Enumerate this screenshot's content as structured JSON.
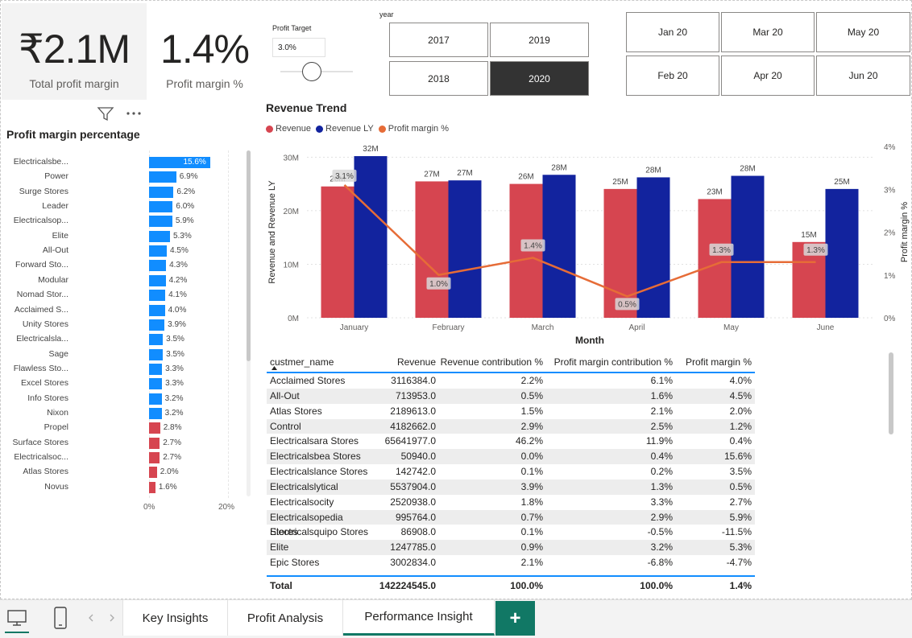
{
  "cards": [
    {
      "value": "₹2.1M",
      "label": "Total profit margin"
    },
    {
      "value": "1.4%",
      "label": "Profit margin %"
    }
  ],
  "profit_target": {
    "label": "Profit Target",
    "value": "3.0%",
    "slider_level": 0.45
  },
  "year_slicer": {
    "label": "year",
    "options": [
      "2017",
      "2019",
      "2018",
      "2020"
    ],
    "selected": "2020"
  },
  "month_slicer": {
    "options": [
      "Jan 20",
      "Mar 20",
      "May 20",
      "Feb 20",
      "Apr 20",
      "Jun 20"
    ]
  },
  "profit_margin_chart": {
    "title": "Profit margin percentage",
    "axis_labels": [
      "0%",
      "20%"
    ],
    "positive_color": "#118dff",
    "negative_color": "#d64550",
    "selected_color": "#118dff",
    "rows": [
      {
        "name": "Electricalsbe...",
        "value": 15.6,
        "label": "15.6%"
      },
      {
        "name": "Power",
        "value": 6.9,
        "label": "6.9%"
      },
      {
        "name": "Surge Stores",
        "value": 6.2,
        "label": "6.2%"
      },
      {
        "name": "Leader",
        "value": 6.0,
        "label": "6.0%"
      },
      {
        "name": "Electricalsop...",
        "value": 5.9,
        "label": "5.9%"
      },
      {
        "name": "Elite",
        "value": 5.3,
        "label": "5.3%"
      },
      {
        "name": "All-Out",
        "value": 4.5,
        "label": "4.5%"
      },
      {
        "name": "Forward Sto...",
        "value": 4.3,
        "label": "4.3%"
      },
      {
        "name": "Modular",
        "value": 4.2,
        "label": "4.2%"
      },
      {
        "name": "Nomad Stor...",
        "value": 4.1,
        "label": "4.1%"
      },
      {
        "name": "Acclaimed S...",
        "value": 4.0,
        "label": "4.0%"
      },
      {
        "name": "Unity Stores",
        "value": 3.9,
        "label": "3.9%"
      },
      {
        "name": "Electricalsla...",
        "value": 3.5,
        "label": "3.5%"
      },
      {
        "name": "Sage",
        "value": 3.5,
        "label": "3.5%"
      },
      {
        "name": "Flawless Sto...",
        "value": 3.3,
        "label": "3.3%"
      },
      {
        "name": "Excel Stores",
        "value": 3.3,
        "label": "3.3%"
      },
      {
        "name": "Info Stores",
        "value": 3.2,
        "label": "3.2%"
      },
      {
        "name": "Nixon",
        "value": 3.2,
        "label": "3.2%"
      },
      {
        "name": "Propel",
        "value": 2.8,
        "label": "2.8%",
        "below_target": true
      },
      {
        "name": "Surface Stores",
        "value": 2.7,
        "label": "2.7%",
        "below_target": true
      },
      {
        "name": "Electricalsoc...",
        "value": 2.7,
        "label": "2.7%",
        "below_target": true
      },
      {
        "name": "Atlas Stores",
        "value": 2.0,
        "label": "2.0%",
        "below_target": true
      },
      {
        "name": "Novus",
        "value": 1.6,
        "label": "1.6%",
        "below_target": true
      }
    ]
  },
  "chart_data": {
    "type": "bar",
    "title": "Revenue Trend",
    "xlabel": "Month",
    "ylabel": "Revenue and Revenue LY",
    "y2label": "Profit margin %",
    "categories": [
      "January",
      "February",
      "March",
      "April",
      "May",
      "June"
    ],
    "ylim": [
      0,
      32
    ],
    "yticks": [
      "0M",
      "10M",
      "20M",
      "30M"
    ],
    "y2lim": [
      0,
      4
    ],
    "y2ticks": [
      "0%",
      "1%",
      "2%",
      "3%",
      "4%"
    ],
    "legend_position": "top-left",
    "grid": true,
    "series": [
      {
        "name": "Revenue",
        "type": "bar",
        "color": "#d64550",
        "values": [
          26,
          27,
          26.5,
          25.5,
          23.5,
          15
        ],
        "labels": [
          "26M",
          "27M",
          "26M",
          "25M",
          "23M",
          "15M"
        ]
      },
      {
        "name": "Revenue LY",
        "type": "bar",
        "color": "#12239e",
        "values": [
          32,
          27.2,
          28.3,
          27.8,
          28.1,
          25.5
        ],
        "labels": [
          "32M",
          "27M",
          "28M",
          "28M",
          "28M",
          "25M"
        ]
      },
      {
        "name": "Profit margin %",
        "type": "line",
        "color": "#e66c37",
        "values": [
          3.1,
          1.0,
          1.4,
          0.5,
          1.3,
          1.3
        ],
        "labels": [
          "3.1%",
          "1.0%",
          "1.4%",
          "0.5%",
          "1.3%",
          "1.3%"
        ]
      }
    ]
  },
  "table": {
    "columns": [
      "custmer_name",
      "Revenue",
      "Revenue contribution %",
      "Profit margin contribution %",
      "Profit margin %"
    ],
    "rows": [
      [
        "Acclaimed Stores",
        "3116384.0",
        "2.2%",
        "6.1%",
        "4.0%"
      ],
      [
        "All-Out",
        "713953.0",
        "0.5%",
        "1.6%",
        "4.5%"
      ],
      [
        "Atlas Stores",
        "2189613.0",
        "1.5%",
        "2.1%",
        "2.0%"
      ],
      [
        "Control",
        "4182662.0",
        "2.9%",
        "2.5%",
        "1.2%"
      ],
      [
        "Electricalsara Stores",
        "65641977.0",
        "46.2%",
        "11.9%",
        "0.4%"
      ],
      [
        "Electricalsbea Stores",
        "50940.0",
        "0.0%",
        "0.4%",
        "15.6%"
      ],
      [
        "Electricalslance Stores",
        "142742.0",
        "0.1%",
        "0.2%",
        "3.5%"
      ],
      [
        "Electricalslytical",
        "5537904.0",
        "3.9%",
        "1.3%",
        "0.5%"
      ],
      [
        "Electricalsocity",
        "2520938.0",
        "1.8%",
        "3.3%",
        "2.7%"
      ],
      [
        "Electricalsopedia Stores",
        "995764.0",
        "0.7%",
        "2.9%",
        "5.9%"
      ],
      [
        "Electricalsquipo Stores",
        "86908.0",
        "0.1%",
        "-0.5%",
        "-11.5%"
      ],
      [
        "Elite",
        "1247785.0",
        "0.9%",
        "3.2%",
        "5.3%"
      ],
      [
        "Epic Stores",
        "3002834.0",
        "2.1%",
        "-6.8%",
        "-4.7%"
      ]
    ],
    "total": [
      "Total",
      "142224545.0",
      "100.0%",
      "100.0%",
      "1.4%"
    ]
  },
  "tabs": [
    {
      "label": "Key Insights"
    },
    {
      "label": "Profit Analysis"
    },
    {
      "label": "Performance Insight",
      "active": true
    }
  ],
  "add_tab_label": "+",
  "header_icons": {
    "filter": "filter-icon",
    "more": "more-options-icon"
  },
  "tabbar_icons": [
    "desktop-view-icon",
    "mobile-view-icon",
    "prev-page-icon",
    "next-page-icon"
  ]
}
